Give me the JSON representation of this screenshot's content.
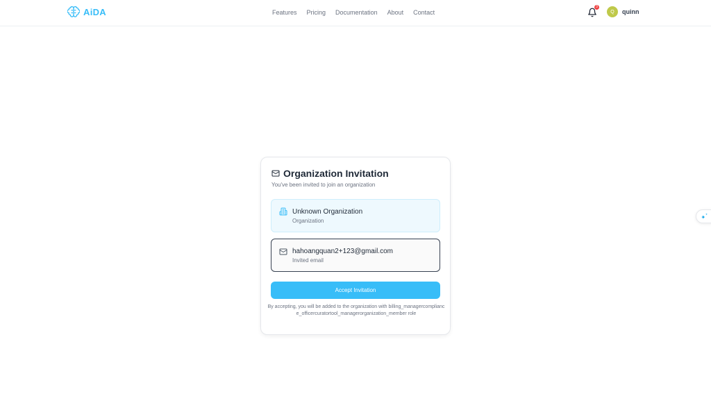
{
  "header": {
    "logo_text": "AiDA",
    "nav": [
      "Features",
      "Pricing",
      "Documentation",
      "About",
      "Contact"
    ],
    "notification_count": "3",
    "user": {
      "initial": "Q",
      "name": "quinn"
    }
  },
  "card": {
    "title": "Organization Invitation",
    "subtitle": "You've been invited to join an organization",
    "organization": {
      "name": "Unknown Organization",
      "label": "Organization"
    },
    "email": {
      "value": "hahoangquan2+123@gmail.com",
      "label": "Invited email"
    },
    "accept_label": "Accept Invitation",
    "note": "By accepting, you will be added to the organization with billing_managercompliance_officercuratortool_managerorganization_member role"
  },
  "colors": {
    "accent": "#38bdf8",
    "badge": "#ef4444",
    "avatar": "#bfc94a"
  },
  "icons": [
    "brain-icon",
    "bell-icon",
    "mail-icon",
    "building-icon",
    "sparkle-icon"
  ]
}
